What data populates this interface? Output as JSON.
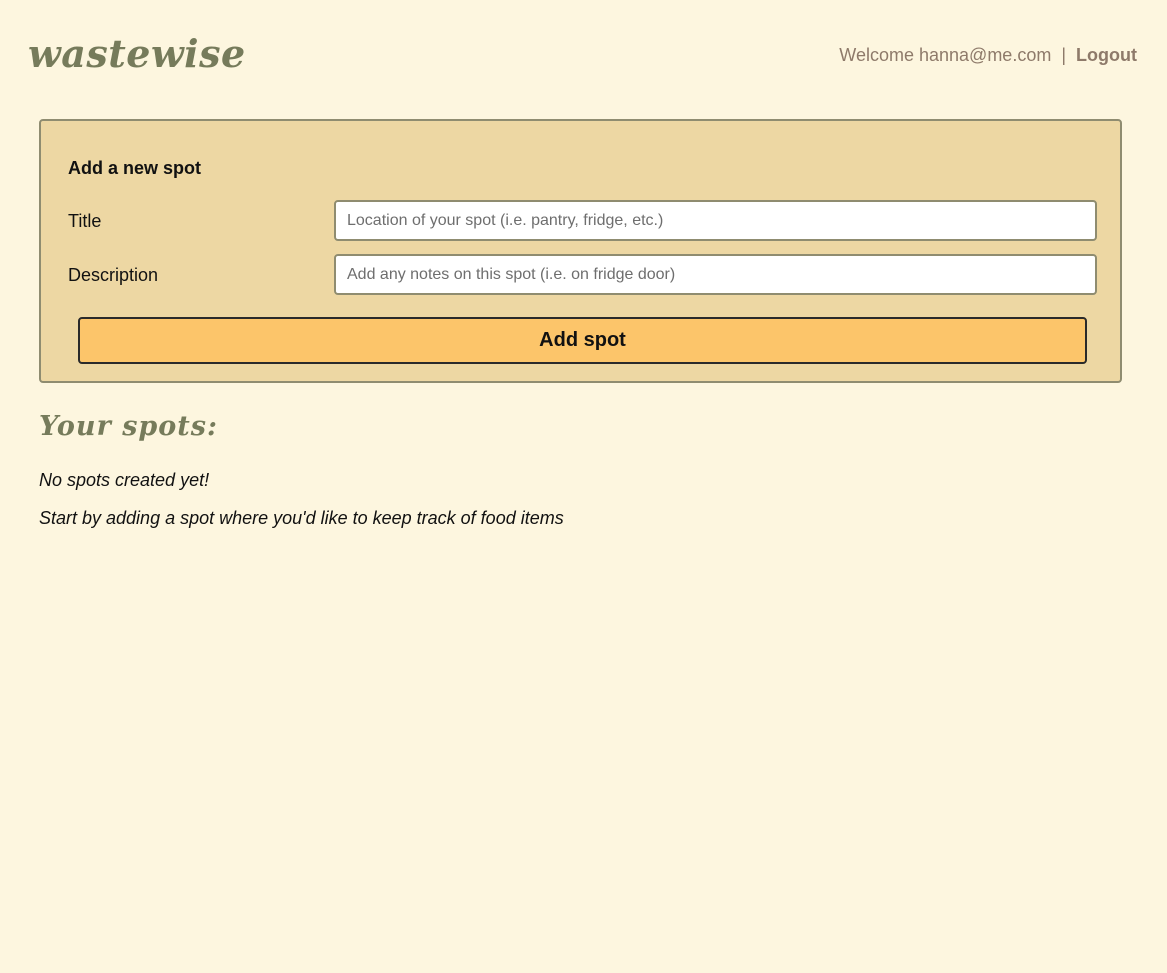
{
  "header": {
    "logo": "wastewise",
    "welcome_text": "Welcome hanna@me.com",
    "separator": "|",
    "logout_label": "Logout"
  },
  "add_spot_form": {
    "title": "Add a new spot",
    "title_label": "Title",
    "title_value": "",
    "title_placeholder": "Location of your spot (i.e. pantry, fridge, etc.)",
    "description_label": "Description",
    "description_value": "",
    "description_placeholder": "Add any notes on this spot (i.e. on fridge door)",
    "submit_label": "Add spot"
  },
  "spots": {
    "heading": "Your spots:",
    "empty_message": "No spots created yet!",
    "empty_hint": "Start by adding a spot where you'd like to keep track of food items",
    "items": []
  },
  "colors": {
    "background": "#fdf6df",
    "brand_olive": "#767b5b",
    "card_background": "#edd7a3",
    "button_accent": "#fcc56a",
    "nav_text": "#8e7a6a"
  }
}
